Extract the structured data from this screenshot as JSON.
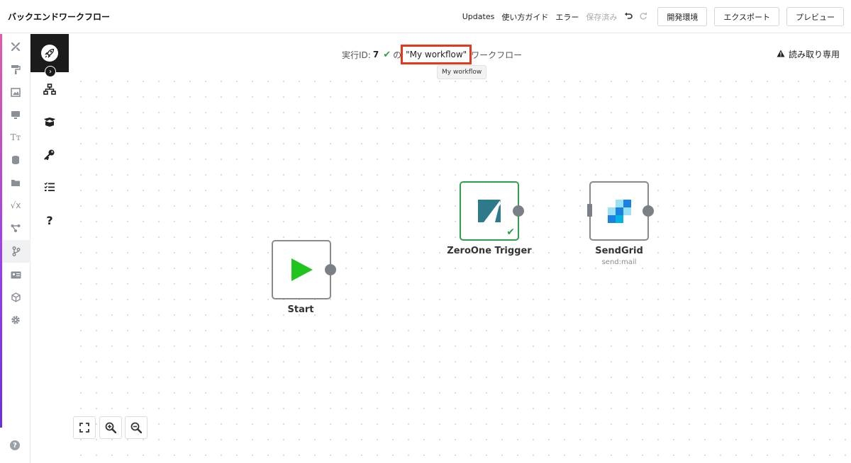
{
  "app": {
    "title": "バックエンドワークフロー"
  },
  "toolbar": {
    "updates": "Updates",
    "guide": "使い方ガイド",
    "errors": "エラー",
    "saved": "保存済み",
    "undo_icon": "undo-icon",
    "redo_icon": "redo-icon",
    "env_button": "開発環境",
    "export_button": "エクスポート",
    "preview_button": "プレビュー"
  },
  "rail": {
    "icons": [
      "tools-icon",
      "paint-roller-icon",
      "image-icon",
      "monitor-icon",
      "text-icon",
      "database-icon",
      "folder-icon",
      "formula-icon",
      "share-nodes-icon",
      "branch-icon",
      "id-card-icon",
      "cube-icon",
      "gear-icon"
    ],
    "help_icon": "?"
  },
  "panel": {
    "icons": [
      "sitemap-icon",
      "box-open-icon",
      "key-icon",
      "checklist-icon",
      "question-icon"
    ]
  },
  "execution": {
    "label": "実行ID:",
    "id": "7",
    "connector": "の",
    "workflow_name": "\"My workflow\"",
    "suffix": "ワークフロー",
    "tooltip": "My workflow"
  },
  "readonly": {
    "label": "読み取り専用"
  },
  "nodes": [
    {
      "label": "Start",
      "sub": ""
    },
    {
      "label": "ZeroOne Trigger",
      "sub": ""
    },
    {
      "label": "SendGrid",
      "sub": "send:mail"
    }
  ],
  "colors": {
    "trigger_border": "#2aa14a",
    "start_play": "#1fc41f",
    "highlight": "#e8361d",
    "accent": "#9b3cf0"
  }
}
